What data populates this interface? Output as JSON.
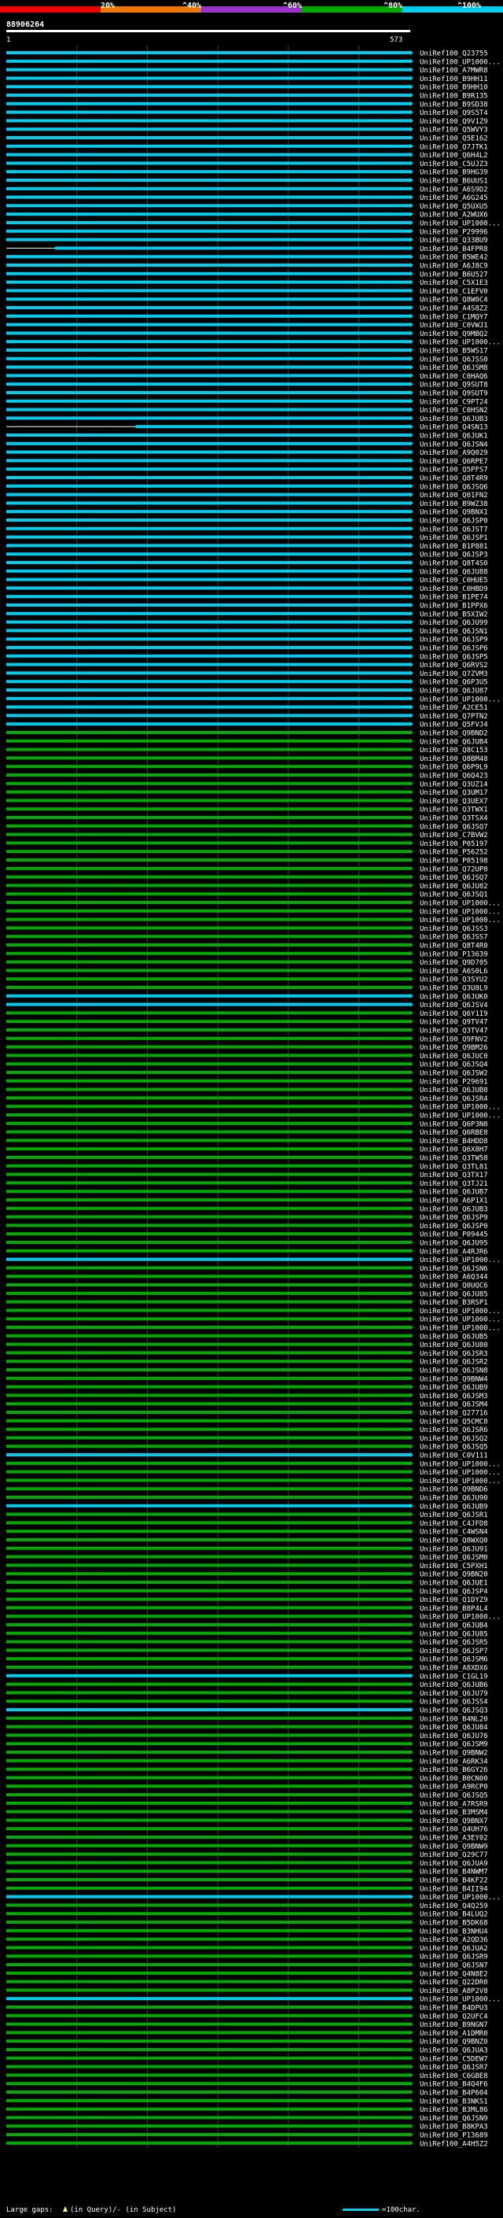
{
  "chart_data": {
    "type": "alignment-overview",
    "title": "88906264",
    "query_start": "1",
    "query_end": "573",
    "identity_scale": [
      "20%",
      "^40%",
      "^60%",
      "^80%",
      "^100%"
    ],
    "identity_colors": [
      "#ee0000",
      "#ee7700",
      "#9933cc",
      "#00aa00",
      "#00ccee"
    ],
    "footer_left": "Large gaps:",
    "footer_gap_legend": "(in Query)/- (in Subject)",
    "footer_scale": "=100char.",
    "query_length": 573,
    "hits": [
      {
        "label": "UniRef100_Q23755",
        "identity": 100
      },
      {
        "label": "UniRef100_UP1000...",
        "identity": 100
      },
      {
        "label": "UniRef100_A7MWR8",
        "identity": 100
      },
      {
        "label": "UniRef100_B9HH11",
        "identity": 100
      },
      {
        "label": "UniRef100_B9HH10",
        "identity": 100
      },
      {
        "label": "UniRef100_B9R135",
        "identity": 100
      },
      {
        "label": "UniRef100_B9SD38",
        "identity": 100
      },
      {
        "label": "UniRef100_Q9S5T4",
        "identity": 100
      },
      {
        "label": "UniRef100_Q9V1Z9",
        "identity": 100
      },
      {
        "label": "UniRef100_Q5WVY3",
        "identity": 100
      },
      {
        "label": "UniRef100_Q5E162",
        "identity": 100
      },
      {
        "label": "UniRef100_Q7JTK1",
        "identity": 100
      },
      {
        "label": "UniRef100_Q6H4L2",
        "identity": 100
      },
      {
        "label": "UniRef100_C5UJZ3",
        "identity": 100
      },
      {
        "label": "UniRef100_B9HG39",
        "identity": 100
      },
      {
        "label": "UniRef100_B6UUS1",
        "identity": 100
      },
      {
        "label": "UniRef100_A6S9D2",
        "identity": 100
      },
      {
        "label": "UniRef100_A6G245",
        "identity": 100
      },
      {
        "label": "UniRef100_Q5UXU5",
        "identity": 100
      },
      {
        "label": "UniRef100_A2WUX6",
        "identity": 100
      },
      {
        "label": "UniRef100_UP1000...",
        "identity": 100
      },
      {
        "label": "UniRef100_P29996",
        "identity": 100
      },
      {
        "label": "UniRef100_Q33BU9",
        "identity": 100
      },
      {
        "label": "UniRef100_B4FPR8",
        "identity": 100,
        "start": 0.12
      },
      {
        "label": "UniRef100_B5WE42",
        "identity": 100
      },
      {
        "label": "UniRef100_A6J8C9",
        "identity": 100
      },
      {
        "label": "UniRef100_B6U527",
        "identity": 100
      },
      {
        "label": "UniRef100_C5X1E3",
        "identity": 100
      },
      {
        "label": "UniRef100_C1EFV0",
        "identity": 100
      },
      {
        "label": "UniRef100_Q8W0C4",
        "identity": 100
      },
      {
        "label": "UniRef100_A4S8Z2",
        "identity": 100
      },
      {
        "label": "UniRef100_C1MQY7",
        "identity": 100
      },
      {
        "label": "UniRef100_C0VWJ1",
        "identity": 100
      },
      {
        "label": "UniRef100_Q9MBQ2",
        "identity": 100
      },
      {
        "label": "UniRef100_UP1000...",
        "identity": 100
      },
      {
        "label": "UniRef100_B5WS17",
        "identity": 100
      },
      {
        "label": "UniRef100_Q6JSS0",
        "identity": 100
      },
      {
        "label": "UniRef100_Q6JSM8",
        "identity": 100
      },
      {
        "label": "UniRef100_C0HAQ6",
        "identity": 100
      },
      {
        "label": "UniRef100_Q9SUT8",
        "identity": 100
      },
      {
        "label": "UniRef100_Q9SUT9",
        "identity": 100
      },
      {
        "label": "UniRef100_C9PT24",
        "identity": 100
      },
      {
        "label": "UniRef100_C0HSN2",
        "identity": 100
      },
      {
        "label": "UniRef100_Q6JUB3",
        "identity": 100
      },
      {
        "label": "UniRef100_Q4SN13",
        "identity": 100,
        "start": 0.32
      },
      {
        "label": "UniRef100_Q6JUK1",
        "identity": 100
      },
      {
        "label": "UniRef100_Q6JSN4",
        "identity": 100
      },
      {
        "label": "UniRef100_A9Q029",
        "identity": 100
      },
      {
        "label": "UniRef100_Q6RPE7",
        "identity": 100
      },
      {
        "label": "UniRef100_Q5PFS7",
        "identity": 100
      },
      {
        "label": "UniRef100_Q8T4R9",
        "identity": 100
      },
      {
        "label": "UniRef100_Q6JSQ6",
        "identity": 100
      },
      {
        "label": "UniRef100_Q01FN2",
        "identity": 100
      },
      {
        "label": "UniRef100_B9WZ38",
        "identity": 100
      },
      {
        "label": "UniRef100_Q9BNX1",
        "identity": 100
      },
      {
        "label": "UniRef100_Q6JSP0",
        "identity": 100
      },
      {
        "label": "UniRef100_Q6JST7",
        "identity": 100
      },
      {
        "label": "UniRef100_Q6JSP1",
        "identity": 100
      },
      {
        "label": "UniRef100_B1P881",
        "identity": 100
      },
      {
        "label": "UniRef100_Q6JSP3",
        "identity": 100
      },
      {
        "label": "UniRef100_Q8T4S0",
        "identity": 100
      },
      {
        "label": "UniRef100_Q6JU88",
        "identity": 100
      },
      {
        "label": "UniRef100_C0HUE5",
        "identity": 100
      },
      {
        "label": "UniRef100_C0HBD9",
        "identity": 100
      },
      {
        "label": "UniRef100_B1PE74",
        "identity": 100
      },
      {
        "label": "UniRef100_B1PPX6",
        "identity": 100
      },
      {
        "label": "UniRef100_B5XIW2",
        "identity": 100
      },
      {
        "label": "UniRef100_Q6JU99",
        "identity": 100
      },
      {
        "label": "UniRef100_Q6JSN1",
        "identity": 100
      },
      {
        "label": "UniRef100_Q6JSP9",
        "identity": 100
      },
      {
        "label": "UniRef100_Q6JSP6",
        "identity": 100
      },
      {
        "label": "UniRef100_Q6JSP5",
        "identity": 100
      },
      {
        "label": "UniRef100_Q6RVS2",
        "identity": 100
      },
      {
        "label": "UniRef100_Q7ZVM3",
        "identity": 100
      },
      {
        "label": "UniRef100_Q6P3U5",
        "identity": 100
      },
      {
        "label": "UniRef100_Q6JU87",
        "identity": 100
      },
      {
        "label": "UniRef100_UP1000...",
        "identity": 100
      },
      {
        "label": "UniRef100_A2CE51",
        "identity": 100
      },
      {
        "label": "UniRef100_Q7PTN2",
        "identity": 100
      },
      {
        "label": "UniRef100_Q5FVJ4",
        "identity": 100
      },
      {
        "label": "UniRef100_Q9BND2",
        "identity": 80
      },
      {
        "label": "UniRef100_Q6JUB4",
        "identity": 80
      },
      {
        "label": "UniRef100_Q8C153",
        "identity": 80
      },
      {
        "label": "UniRef100_Q8BM48",
        "identity": 80
      },
      {
        "label": "UniRef100_Q6P9L9",
        "identity": 80
      },
      {
        "label": "UniRef100_Q6Q423",
        "identity": 80
      },
      {
        "label": "UniRef100_Q3UZ14",
        "identity": 80
      },
      {
        "label": "UniRef100_Q3UM17",
        "identity": 80
      },
      {
        "label": "UniRef100_Q3UEX7",
        "identity": 80
      },
      {
        "label": "UniRef100_Q3TWX1",
        "identity": 80
      },
      {
        "label": "UniRef100_Q3TSX4",
        "identity": 80
      },
      {
        "label": "UniRef100_Q6JSQ7",
        "identity": 80
      },
      {
        "label": "UniRef100_C7BVW2",
        "identity": 80
      },
      {
        "label": "UniRef100_P05197",
        "identity": 80
      },
      {
        "label": "UniRef100_P56252",
        "identity": 80
      },
      {
        "label": "UniRef100_P05198",
        "identity": 80
      },
      {
        "label": "UniRef100_Q72UP8",
        "identity": 80
      },
      {
        "label": "UniRef100_Q6JSQ7",
        "identity": 80
      },
      {
        "label": "UniRef100_Q6JU82",
        "identity": 80
      },
      {
        "label": "UniRef100_Q6JSQ1",
        "identity": 80
      },
      {
        "label": "UniRef100_UP1000...",
        "identity": 80
      },
      {
        "label": "UniRef100_UP1000...",
        "identity": 80
      },
      {
        "label": "UniRef100_UP1000...",
        "identity": 80
      },
      {
        "label": "UniRef100_Q6JSS3",
        "identity": 80
      },
      {
        "label": "UniRef100_Q6JSS7",
        "identity": 80
      },
      {
        "label": "UniRef100_Q8T4R0",
        "identity": 80
      },
      {
        "label": "UniRef100_P13639",
        "identity": 80
      },
      {
        "label": "UniRef100_Q9D705",
        "identity": 80
      },
      {
        "label": "UniRef100_A6S0L6",
        "identity": 80
      },
      {
        "label": "UniRef100_Q3SYU2",
        "identity": 80
      },
      {
        "label": "UniRef100_Q3U8L9",
        "identity": 80
      },
      {
        "label": "UniRef100_Q6JUK0",
        "identity": 100
      },
      {
        "label": "UniRef100_Q6JSV4",
        "identity": 100
      },
      {
        "label": "UniRef100_Q6Y1I9",
        "identity": 80
      },
      {
        "label": "UniRef100_Q9TV47",
        "identity": 80
      },
      {
        "label": "UniRef100_Q3TV47",
        "identity": 80
      },
      {
        "label": "UniRef100_Q9FNV2",
        "identity": 80
      },
      {
        "label": "UniRef100_Q9BM26",
        "identity": 80
      },
      {
        "label": "UniRef100_Q6JUC0",
        "identity": 80
      },
      {
        "label": "UniRef100_Q6JSQ4",
        "identity": 80
      },
      {
        "label": "UniRef100_Q6JSW2",
        "identity": 80
      },
      {
        "label": "UniRef100_P29691",
        "identity": 80
      },
      {
        "label": "UniRef100_Q6JUB8",
        "identity": 80
      },
      {
        "label": "UniRef100_Q6JSR4",
        "identity": 80
      },
      {
        "label": "UniRef100_UP1000...",
        "identity": 80
      },
      {
        "label": "UniRef100_UP1000...",
        "identity": 80
      },
      {
        "label": "UniRef100_Q6P3N8",
        "identity": 80
      },
      {
        "label": "UniRef100_Q6RBE8",
        "identity": 80
      },
      {
        "label": "UniRef100_B4HDD8",
        "identity": 80
      },
      {
        "label": "UniRef100_Q6X8H7",
        "identity": 80
      },
      {
        "label": "UniRef100_Q3TW58",
        "identity": 80
      },
      {
        "label": "UniRef100_Q3TL81",
        "identity": 80
      },
      {
        "label": "UniRef100_Q3TX17",
        "identity": 80
      },
      {
        "label": "UniRef100_Q3TJ21",
        "identity": 80
      },
      {
        "label": "UniRef100_Q6JUB7",
        "identity": 80
      },
      {
        "label": "UniRef100_A6P1X1",
        "identity": 80
      },
      {
        "label": "UniRef100_Q6JUB3",
        "identity": 80
      },
      {
        "label": "UniRef100_Q6JSP9",
        "identity": 80
      },
      {
        "label": "UniRef100_Q6JSP0",
        "identity": 80
      },
      {
        "label": "UniRef100_P09445",
        "identity": 80
      },
      {
        "label": "UniRef100_Q6JU95",
        "identity": 80
      },
      {
        "label": "UniRef100_A4RJR6",
        "identity": 80
      },
      {
        "label": "UniRef100_UP1000...",
        "identity": 100
      },
      {
        "label": "UniRef100_Q6JSN6",
        "identity": 80
      },
      {
        "label": "UniRef100_A6Q344",
        "identity": 80
      },
      {
        "label": "UniRef100_Q0UQC6",
        "identity": 80
      },
      {
        "label": "UniRef100_Q6JU85",
        "identity": 80
      },
      {
        "label": "UniRef100_B3RSP1",
        "identity": 80
      },
      {
        "label": "UniRef100_UP1000...",
        "identity": 80
      },
      {
        "label": "UniRef100_UP1000...",
        "identity": 80
      },
      {
        "label": "UniRef100_UP1000...",
        "identity": 80
      },
      {
        "label": "UniRef100_Q6JUB5",
        "identity": 80
      },
      {
        "label": "UniRef100_Q6JU80",
        "identity": 80
      },
      {
        "label": "UniRef100_Q6JSR3",
        "identity": 80
      },
      {
        "label": "UniRef100_Q6JSR2",
        "identity": 80
      },
      {
        "label": "UniRef100_Q6JSN8",
        "identity": 80
      },
      {
        "label": "UniRef100_Q9BNW4",
        "identity": 80
      },
      {
        "label": "UniRef100_Q6JUB9",
        "identity": 80
      },
      {
        "label": "UniRef100_Q6JSM3",
        "identity": 80
      },
      {
        "label": "UniRef100_Q6JSM4",
        "identity": 80
      },
      {
        "label": "UniRef100_Q27716",
        "identity": 80
      },
      {
        "label": "UniRef100_Q5CMC8",
        "identity": 80
      },
      {
        "label": "UniRef100_Q6JSR6",
        "identity": 80
      },
      {
        "label": "UniRef100_Q6JSQ2",
        "identity": 80
      },
      {
        "label": "UniRef100_Q6JSQ5",
        "identity": 80
      },
      {
        "label": "UniRef100_C0V111",
        "identity": 100
      },
      {
        "label": "UniRef100_UP1000...",
        "identity": 80
      },
      {
        "label": "UniRef100_UP1000...",
        "identity": 80
      },
      {
        "label": "UniRef100_UP1000...",
        "identity": 80
      },
      {
        "label": "UniRef100_Q9BND6",
        "identity": 80
      },
      {
        "label": "UniRef100_Q6JU90",
        "identity": 80
      },
      {
        "label": "UniRef100_Q6JUB9",
        "identity": 100
      },
      {
        "label": "UniRef100_Q6JSR1",
        "identity": 80
      },
      {
        "label": "UniRef100_C4JFD8",
        "identity": 80
      },
      {
        "label": "UniRef100_C4WSN4",
        "identity": 80
      },
      {
        "label": "UniRef100_Q8WXQ0",
        "identity": 80
      },
      {
        "label": "UniRef100_Q6JU91",
        "identity": 80
      },
      {
        "label": "UniRef100_Q6JSM0",
        "identity": 80
      },
      {
        "label": "UniRef100_C5PXH1",
        "identity": 80
      },
      {
        "label": "UniRef100_Q9BN20",
        "identity": 80
      },
      {
        "label": "UniRef100_Q6JUE1",
        "identity": 80
      },
      {
        "label": "UniRef100_Q6JSP4",
        "identity": 80
      },
      {
        "label": "UniRef100_Q1DYZ9",
        "identity": 80
      },
      {
        "label": "UniRef100_B8P4L4",
        "identity": 80
      },
      {
        "label": "UniRef100_UP1000...",
        "identity": 80
      },
      {
        "label": "UniRef100_Q6JUB4",
        "identity": 80
      },
      {
        "label": "UniRef100_Q6JU85",
        "identity": 80
      },
      {
        "label": "UniRef100_Q6JSR5",
        "identity": 80
      },
      {
        "label": "UniRef100_Q6JSP7",
        "identity": 80
      },
      {
        "label": "UniRef100_Q6JSM6",
        "identity": 80
      },
      {
        "label": "UniRef100_A8XDX6",
        "identity": 80
      },
      {
        "label": "UniRef100_C1GL19",
        "identity": 100
      },
      {
        "label": "UniRef100_Q6JUB6",
        "identity": 80
      },
      {
        "label": "UniRef100_Q6JU79",
        "identity": 80
      },
      {
        "label": "UniRef100_Q6JSS4",
        "identity": 80
      },
      {
        "label": "UniRef100_Q6JSQ3",
        "identity": 100
      },
      {
        "label": "UniRef100_B4NL20",
        "identity": 80
      },
      {
        "label": "UniRef100_Q6JU84",
        "identity": 80
      },
      {
        "label": "UniRef100_Q6JU76",
        "identity": 80
      },
      {
        "label": "UniRef100_Q6JSM9",
        "identity": 80
      },
      {
        "label": "UniRef100_Q9BNW2",
        "identity": 80
      },
      {
        "label": "UniRef100_A6RK34",
        "identity": 80
      },
      {
        "label": "UniRef100_B6GY26",
        "identity": 80
      },
      {
        "label": "UniRef100_B0CN00",
        "identity": 80
      },
      {
        "label": "UniRef100_A9RCP0",
        "identity": 80
      },
      {
        "label": "UniRef100_Q6JSQ5",
        "identity": 80
      },
      {
        "label": "UniRef100_A7RSR9",
        "identity": 80
      },
      {
        "label": "UniRef100_B3MSM4",
        "identity": 80
      },
      {
        "label": "UniRef100_Q9BNX7",
        "identity": 80
      },
      {
        "label": "UniRef100_Q4UH76",
        "identity": 80
      },
      {
        "label": "UniRef100_A3EY02",
        "identity": 80
      },
      {
        "label": "UniRef100_Q9BNW9",
        "identity": 80
      },
      {
        "label": "UniRef100_Q29C77",
        "identity": 80
      },
      {
        "label": "UniRef100_Q6JUA9",
        "identity": 80
      },
      {
        "label": "UniRef100_B4NWM7",
        "identity": 80
      },
      {
        "label": "UniRef100_B4KF22",
        "identity": 80
      },
      {
        "label": "UniRef100_B4II94",
        "identity": 80
      },
      {
        "label": "UniRef100_UP1000...",
        "identity": 100
      },
      {
        "label": "UniRef100_Q4Q259",
        "identity": 80
      },
      {
        "label": "UniRef100_B4LUQ2",
        "identity": 80
      },
      {
        "label": "UniRef100_B5DK68",
        "identity": 80
      },
      {
        "label": "UniRef100_B3NHU4",
        "identity": 80
      },
      {
        "label": "UniRef100_A2QD36",
        "identity": 80
      },
      {
        "label": "UniRef100_Q6JUA2",
        "identity": 80
      },
      {
        "label": "UniRef100_Q6JSR9",
        "identity": 80
      },
      {
        "label": "UniRef100_Q6JSN7",
        "identity": 80
      },
      {
        "label": "UniRef100_Q4N8E2",
        "identity": 80
      },
      {
        "label": "UniRef100_Q22DR0",
        "identity": 80
      },
      {
        "label": "UniRef100_A8P2V8",
        "identity": 80
      },
      {
        "label": "UniRef100_UP1000...",
        "identity": 100
      },
      {
        "label": "UniRef100_B4DPU3",
        "identity": 80
      },
      {
        "label": "UniRef100_Q2UFC4",
        "identity": 80
      },
      {
        "label": "UniRef100_B9NGN7",
        "identity": 80
      },
      {
        "label": "UniRef100_A1DMR0",
        "identity": 80
      },
      {
        "label": "UniRef100_Q9BNZ0",
        "identity": 80
      },
      {
        "label": "UniRef100_Q6JUA3",
        "identity": 80
      },
      {
        "label": "UniRef100_C5DEW7",
        "identity": 80
      },
      {
        "label": "UniRef100_Q6JSR7",
        "identity": 80
      },
      {
        "label": "UniRef100_C6GBE8",
        "identity": 80
      },
      {
        "label": "UniRef100_B4Q4F6",
        "identity": 80
      },
      {
        "label": "UniRef100_B4P604",
        "identity": 80
      },
      {
        "label": "UniRef100_B3NKS1",
        "identity": 80
      },
      {
        "label": "UniRef100_B3ML86",
        "identity": 80
      },
      {
        "label": "UniRef100_Q6JSN9",
        "identity": 80
      },
      {
        "label": "UniRef100_B8KPA3",
        "identity": 80
      },
      {
        "label": "UniRef100_P13689",
        "identity": 80
      },
      {
        "label": "UniRef100_A4H5Z2",
        "identity": 80
      }
    ]
  }
}
